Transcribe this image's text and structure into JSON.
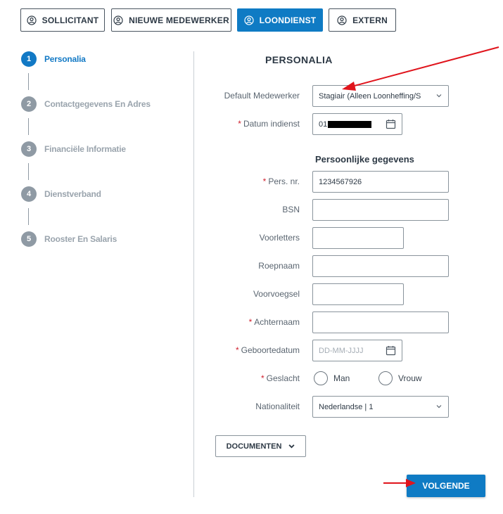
{
  "roles": [
    {
      "label": "SOLLICITANT",
      "active": false
    },
    {
      "label": "NIEUWE MEDEWERKER",
      "active": false
    },
    {
      "label": "LOONDIENST",
      "active": true
    },
    {
      "label": "EXTERN",
      "active": false
    }
  ],
  "steps": [
    {
      "number": "1",
      "label": "Personalia",
      "active": true
    },
    {
      "number": "2",
      "label": "Contactgegevens En Adres",
      "active": false
    },
    {
      "number": "3",
      "label": "Financiële Informatie",
      "active": false
    },
    {
      "number": "4",
      "label": "Dienstverband",
      "active": false
    },
    {
      "number": "5",
      "label": "Rooster En Salaris",
      "active": false
    }
  ],
  "form": {
    "title": "PERSONALIA",
    "default_medewerker": {
      "label": "Default Medewerker",
      "value": "Stagiair (Alleen Loonheffing/S"
    },
    "datum_indienst": {
      "label": "Datum indienst",
      "value": "01",
      "required": true
    },
    "subsection_title": "Persoonlijke gegevens",
    "pers_nr": {
      "label": "Pers. nr.",
      "value": "1234567926",
      "required": true
    },
    "bsn": {
      "label": "BSN",
      "value": ""
    },
    "voorletters": {
      "label": "Voorletters",
      "value": ""
    },
    "roepnaam": {
      "label": "Roepnaam",
      "value": ""
    },
    "voorvoegsel": {
      "label": "Voorvoegsel",
      "value": ""
    },
    "achternaam": {
      "label": "Achternaam",
      "value": "",
      "required": true
    },
    "geboortedatum": {
      "label": "Geboortedatum",
      "placeholder": "DD-MM-JJJJ",
      "required": true
    },
    "geslacht": {
      "label": "Geslacht",
      "required": true,
      "options": [
        "Man",
        "Vrouw"
      ]
    },
    "nationaliteit": {
      "label": "Nationaliteit",
      "value": "Nederlandse | 1"
    },
    "required_marker": "*"
  },
  "documents_button": "DOCUMENTEN",
  "next_button": "VOLGENDE",
  "colors": {
    "primary": "#0f7bc4",
    "required": "#d0202e",
    "annotation_arrow": "#e0141c",
    "inactive_step": "#8f9aa4"
  },
  "icons": [
    "user-circle-icon",
    "calendar-icon",
    "chevron-down-icon"
  ]
}
